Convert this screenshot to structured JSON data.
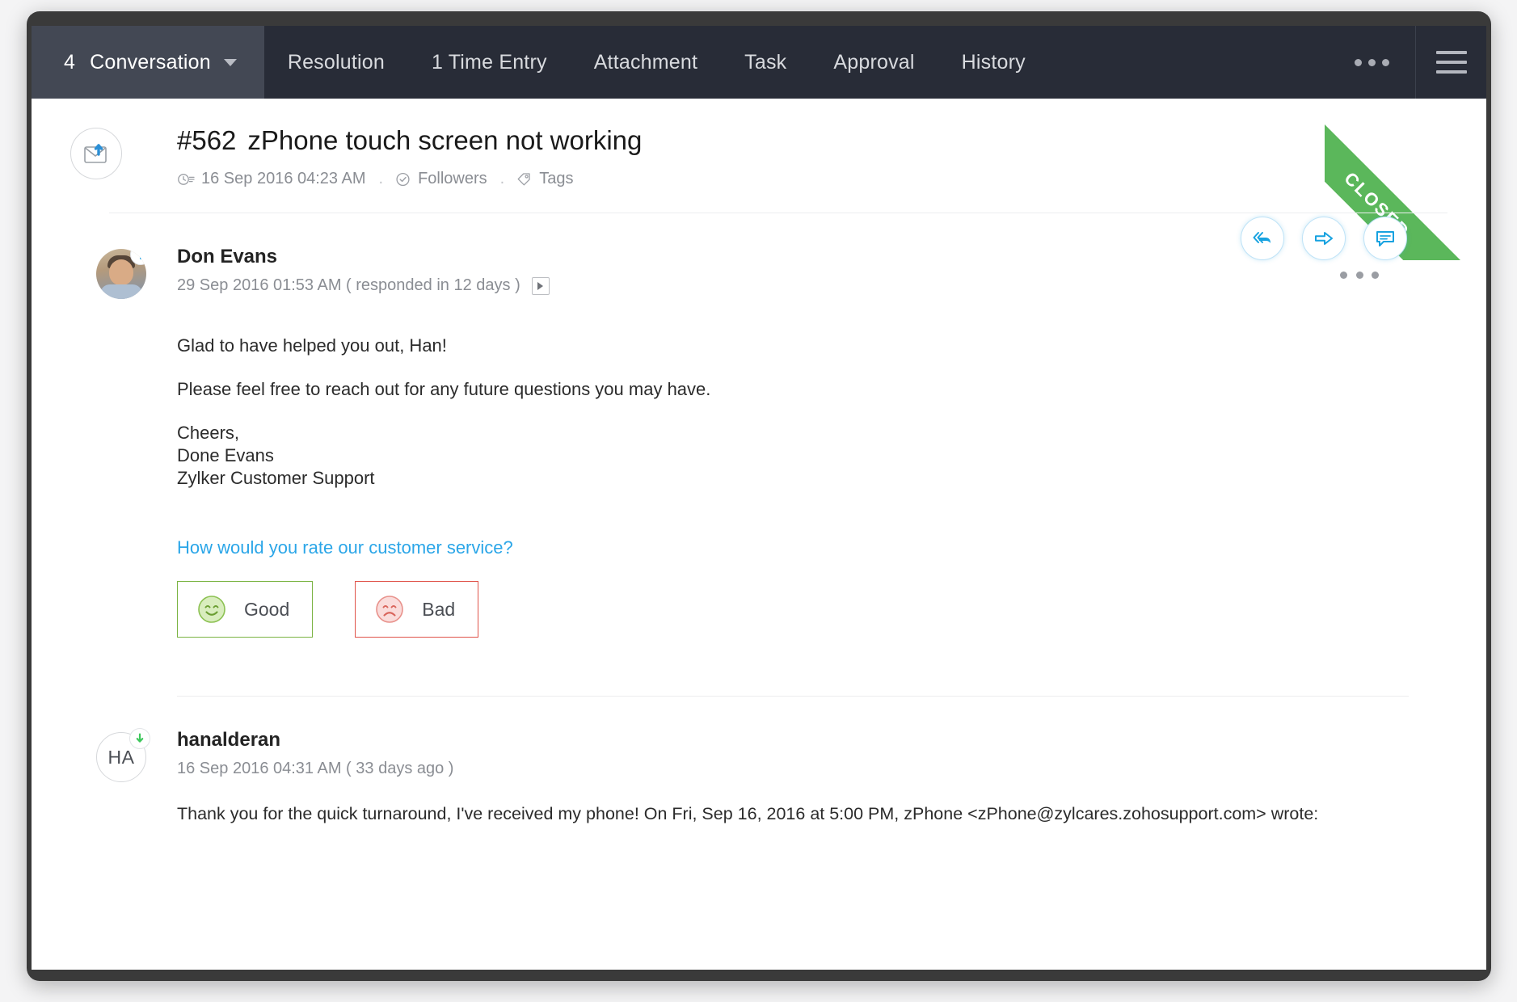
{
  "tabs": [
    {
      "count": "4",
      "label": "Conversation",
      "active": true,
      "caret": true
    },
    {
      "count": "",
      "label": "Resolution",
      "active": false,
      "caret": false
    },
    {
      "count": "",
      "label": "1 Time Entry",
      "active": false,
      "caret": false
    },
    {
      "count": "",
      "label": "Attachment",
      "active": false,
      "caret": false
    },
    {
      "count": "",
      "label": "Task",
      "active": false,
      "caret": false
    },
    {
      "count": "",
      "label": "Approval",
      "active": false,
      "caret": false
    },
    {
      "count": "",
      "label": "History",
      "active": false,
      "caret": false
    }
  ],
  "header": {
    "more_icon": "ellipsis-icon",
    "menu_icon": "hamburger-menu-icon"
  },
  "ticket": {
    "number": "#562",
    "title": "zPhone touch screen not working",
    "created": "16 Sep 2016 04:23 AM",
    "followers_label": "Followers",
    "tags_label": "Tags",
    "status_ribbon": "CLOSED",
    "status_color": "#5bb75b",
    "channel_icon": "email-outgoing-icon"
  },
  "actions": [
    {
      "name": "reply-all-icon",
      "title": "Reply All"
    },
    {
      "name": "forward-icon",
      "title": "Forward"
    },
    {
      "name": "comment-icon",
      "title": "Comment"
    }
  ],
  "messages": [
    {
      "author": "Don Evans",
      "time": "29 Sep 2016 01:53 AM ( responded in 12 days )",
      "avatar_type": "photo",
      "badge_icon": "reply-badge-icon",
      "badge_color": "#2ba6e8",
      "has_play": true,
      "paragraphs": [
        "Glad to have helped you out, Han!",
        "Please feel free to reach out for any future questions you may have."
      ],
      "signature": [
        "Cheers,",
        "Done Evans",
        "Zylker Customer Support"
      ]
    },
    {
      "author": "hanalderan",
      "time": "16 Sep 2016 04:31 AM ( 33 days ago )",
      "avatar_type": "initials",
      "initials": "HA",
      "badge_icon": "incoming-badge-icon",
      "badge_color": "#3dc75b",
      "has_play": false,
      "paragraphs": [
        "Thank you for the quick turnaround, I've received my phone! On Fri, Sep 16, 2016 at 5:00 PM, zPhone <zPhone@zylcares.zohosupport.com> wrote:"
      ]
    }
  ],
  "rating": {
    "question": "How would you rate our customer service?",
    "good_label": "Good",
    "bad_label": "Bad",
    "good_color": "#7ab342",
    "bad_color": "#e0534a"
  }
}
